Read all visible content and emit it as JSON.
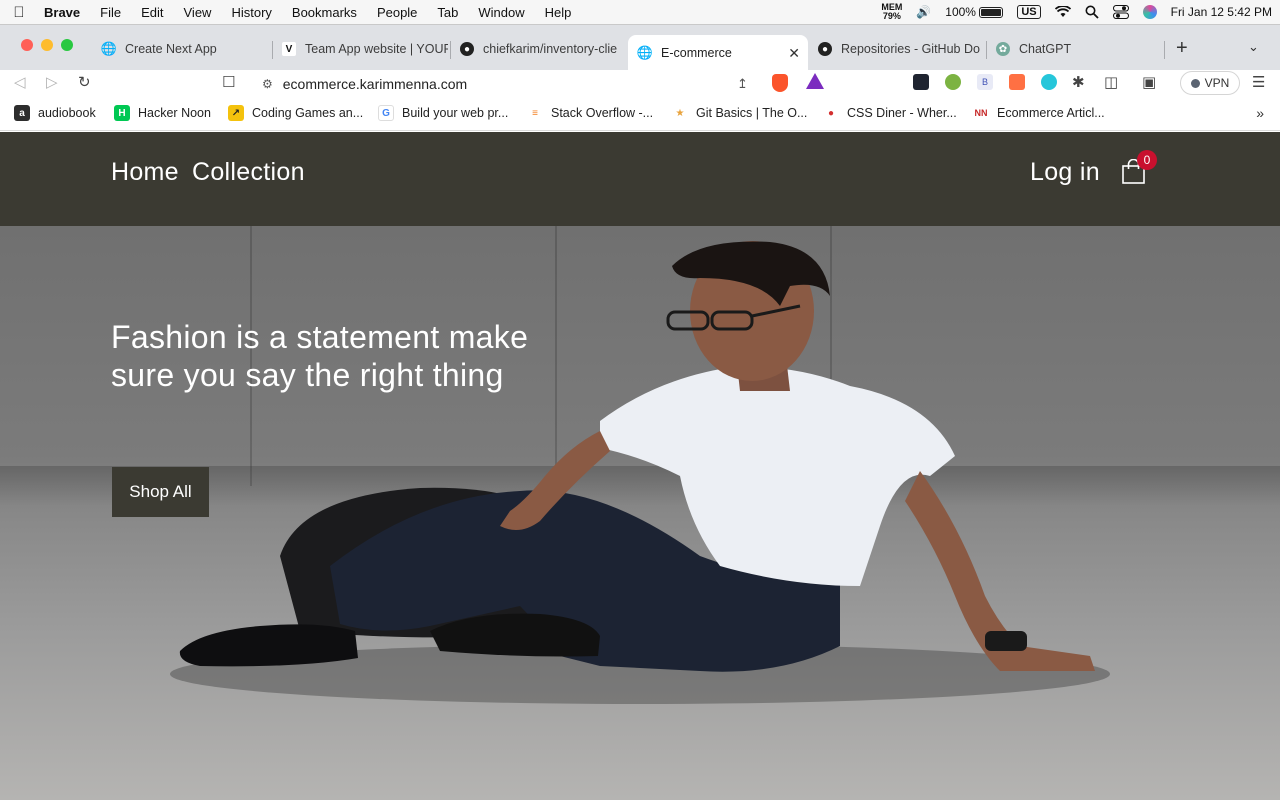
{
  "menubar": {
    "app_name": "Brave",
    "items": [
      "File",
      "Edit",
      "View",
      "History",
      "Bookmarks",
      "People",
      "Tab",
      "Window",
      "Help"
    ],
    "mem_label": "MEM",
    "mem_value": "79%",
    "battery": "100%",
    "keyboard": "US",
    "datetime": "Fri Jan 12  5:42 PM"
  },
  "tabs": [
    {
      "title": "Create Next App",
      "icon": "globe-icon"
    },
    {
      "title": "Team App website | YOUR",
      "icon": "v-logo-icon"
    },
    {
      "title": "chiefkarim/inventory-clie",
      "icon": "github-icon"
    },
    {
      "title": "E-commerce",
      "icon": "globe-icon",
      "active": true
    },
    {
      "title": "Repositories - GitHub Do",
      "icon": "github-icon"
    },
    {
      "title": "ChatGPT",
      "icon": "chatgpt-icon"
    }
  ],
  "address": {
    "url": "ecommerce.karimmenna.com"
  },
  "toolbar": {
    "vpn_label": "VPN"
  },
  "bookmarks": [
    {
      "label": "audiobook",
      "color": "#2d2d2d"
    },
    {
      "label": "Hacker Noon",
      "color": "#00c853"
    },
    {
      "label": "Coding Games an...",
      "color": "#f4c20d"
    },
    {
      "label": "Build your web pr...",
      "color": "#4285f4"
    },
    {
      "label": "Stack Overflow -...",
      "color": "#f48024"
    },
    {
      "label": "Git Basics | The O...",
      "color": "#e8a33d"
    },
    {
      "label": "CSS Diner - Wher...",
      "color": "#d32f2f"
    },
    {
      "label": "Ecommerce Articl...",
      "color": "#c62828"
    }
  ],
  "site": {
    "nav": {
      "home": "Home",
      "collection": "Collection",
      "login": "Log in"
    },
    "cart_count": "0",
    "hero": {
      "heading": "Fashion is a statement make sure you say the right thing",
      "cta": "Shop All"
    },
    "colors": {
      "header_bg": "#3b3a32",
      "badge": "#c8102e"
    }
  }
}
